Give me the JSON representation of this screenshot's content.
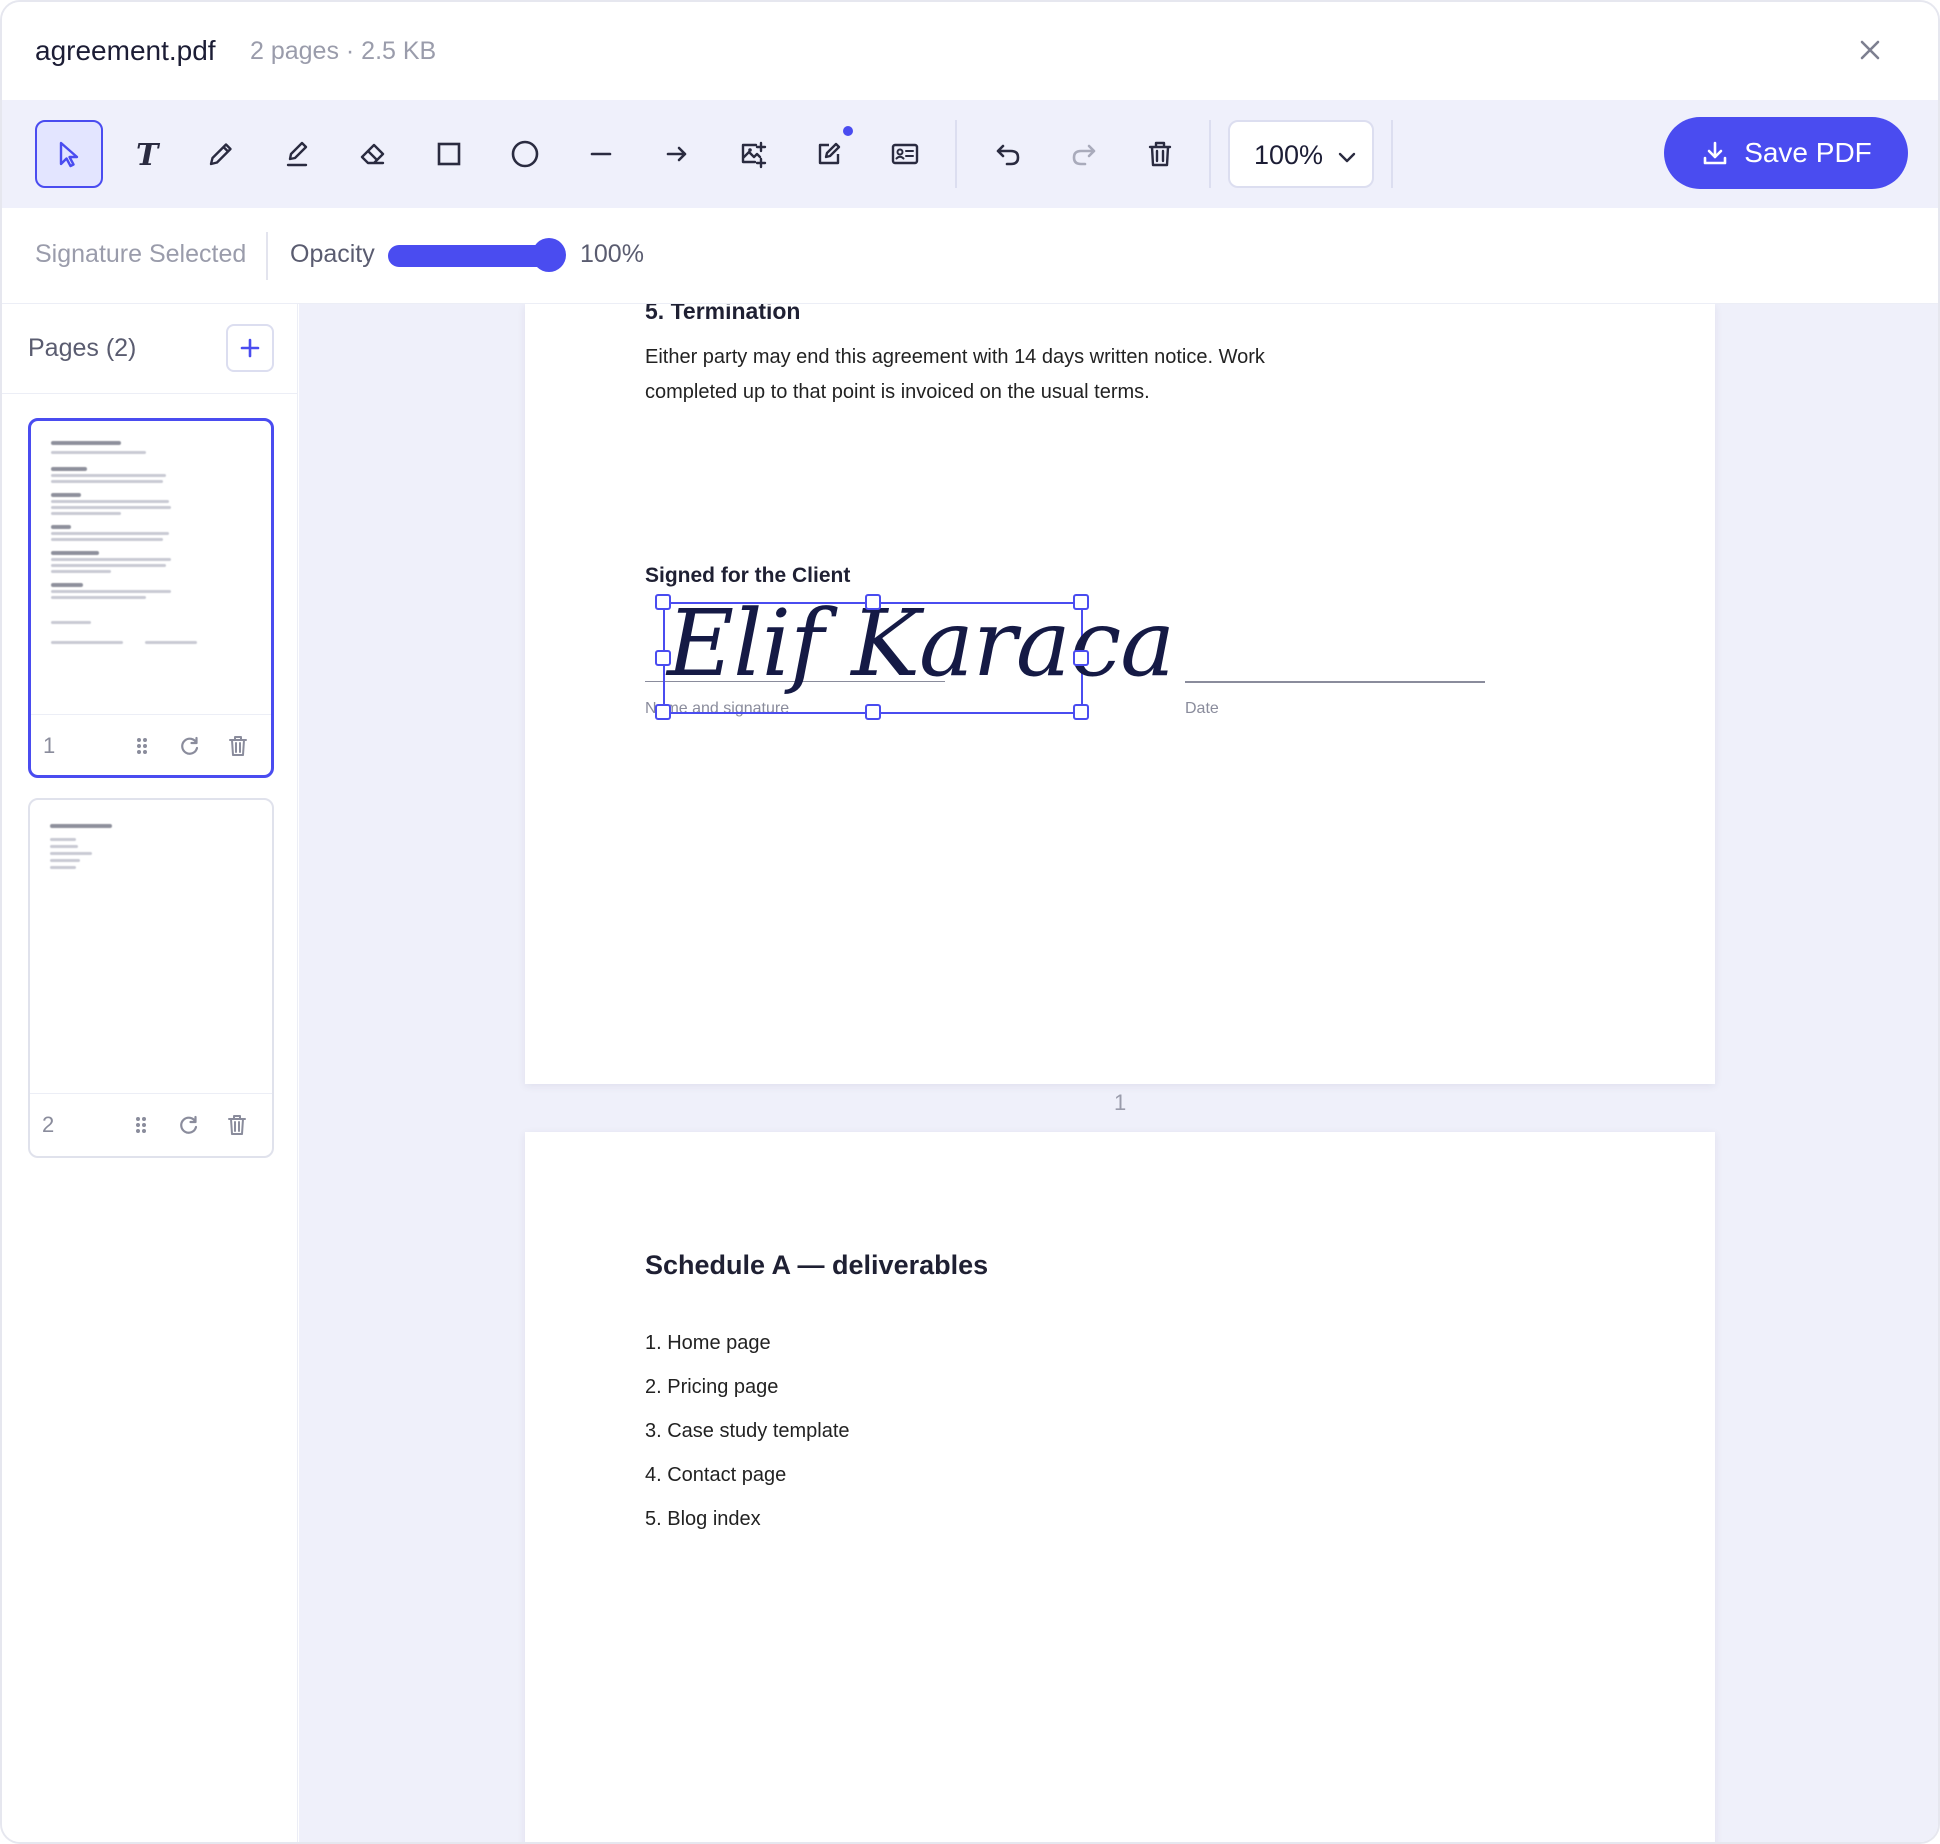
{
  "header": {
    "file_name": "agreement.pdf",
    "file_meta": "2 pages · 2.5 KB"
  },
  "toolbar": {
    "tools": [
      {
        "name": "select-tool",
        "icon": "pointer-icon"
      },
      {
        "name": "text-tool",
        "icon": "text-icon"
      },
      {
        "name": "draw-tool",
        "icon": "pencil-icon"
      },
      {
        "name": "highlight-tool",
        "icon": "highlighter-icon"
      },
      {
        "name": "eraser-tool",
        "icon": "eraser-icon"
      },
      {
        "name": "rectangle-tool",
        "icon": "rectangle-icon"
      },
      {
        "name": "circle-tool",
        "icon": "circle-icon"
      },
      {
        "name": "line-tool",
        "icon": "line-icon"
      },
      {
        "name": "arrow-tool",
        "icon": "arrow-icon"
      },
      {
        "name": "image-tool",
        "icon": "image-add-icon"
      },
      {
        "name": "signature-tool",
        "icon": "signature-edit-icon"
      },
      {
        "name": "id-card-tool",
        "icon": "id-card-icon"
      },
      {
        "name": "undo-button",
        "icon": "undo-icon"
      },
      {
        "name": "redo-button",
        "icon": "redo-icon"
      },
      {
        "name": "delete-button",
        "icon": "trash-icon"
      }
    ],
    "zoom": "100%",
    "save_label": "Save PDF"
  },
  "options": {
    "selection_label": "Signature Selected",
    "opacity_label": "Opacity",
    "opacity_value": "100%",
    "opacity_level": 1.0
  },
  "sidebar": {
    "title": "Pages (2)",
    "pages": [
      {
        "number": "1",
        "selected": true
      },
      {
        "number": "2",
        "selected": false
      }
    ]
  },
  "document": {
    "page1": {
      "section_title": "5.  Termination",
      "paragraph": "Either party may end this agreement with 14 days written notice. Work completed up to that point is invoiced on the usual terms.",
      "signed_label": "Signed for the Client",
      "signature": "Elif Karaca",
      "name_caption": "Name and signature",
      "date_caption": "Date",
      "page_number": "1"
    },
    "page2": {
      "title": "Schedule A — deliverables",
      "items": [
        "1.  Home page",
        "2.  Pricing page",
        "3.  Case study template",
        "4.  Contact page",
        "5.  Blog index"
      ]
    }
  },
  "colors": {
    "accent": "#4a4cf0",
    "toolbar_bg": "#eff0fb",
    "canvas_bg": "#eff0fa",
    "signature_ink": "#151a45"
  }
}
